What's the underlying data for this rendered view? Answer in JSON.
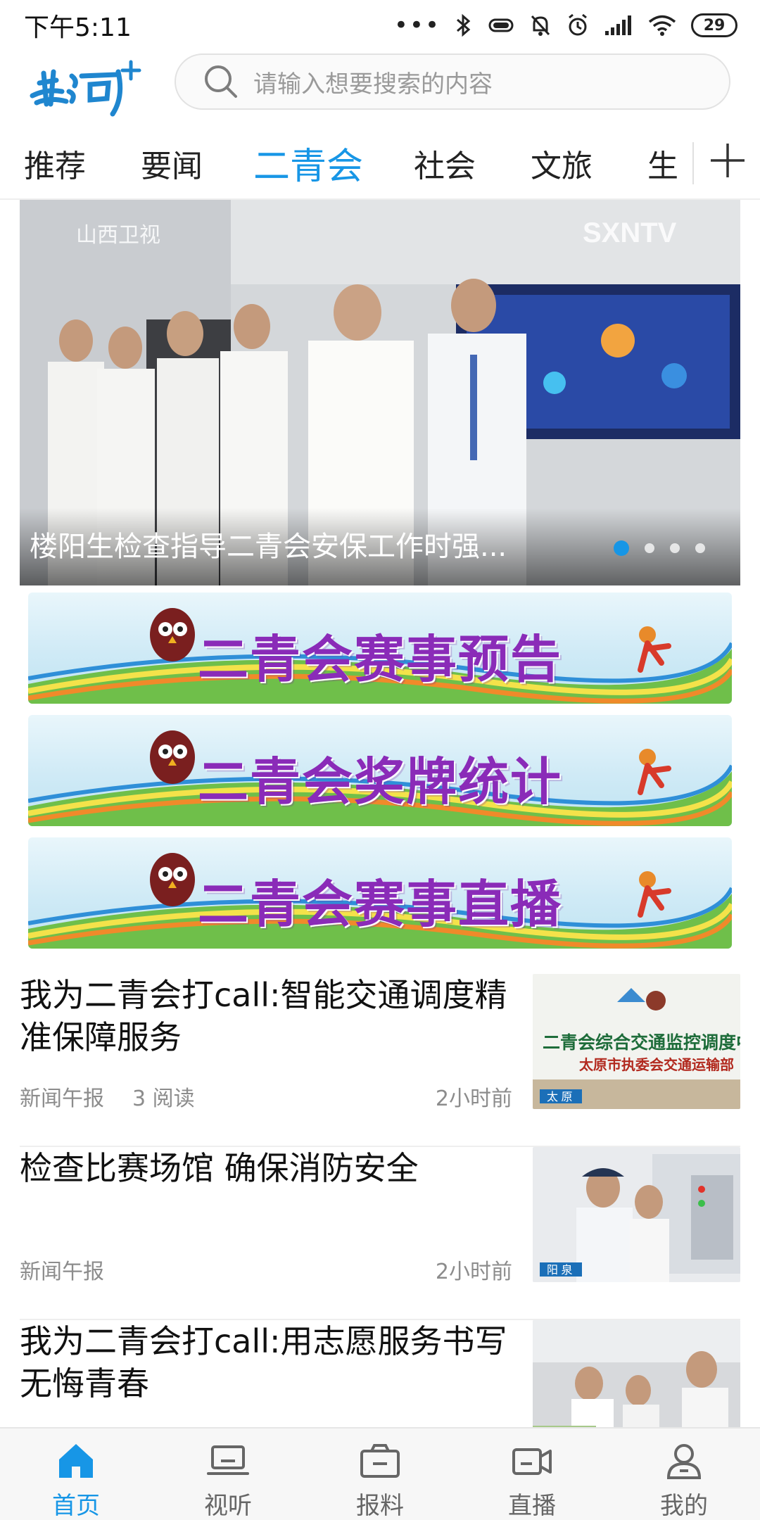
{
  "status_bar": {
    "time": "下午5:11",
    "more_dots": "•••",
    "battery": "29"
  },
  "header": {
    "logo_icon": "huanghe-plus-logo",
    "search": {
      "placeholder": "请输入想要搜索的内容",
      "icon": "search-icon"
    }
  },
  "tabs": {
    "items": [
      {
        "label": "推荐"
      },
      {
        "label": "要闻"
      },
      {
        "label": "二青会",
        "active": true
      },
      {
        "label": "社会"
      },
      {
        "label": "文旅"
      },
      {
        "label": "生"
      }
    ],
    "add_icon": "plus-icon"
  },
  "hero": {
    "title": "楼阳生检查指导二青会安保工作时强...",
    "page_count": 4,
    "active_page": 1,
    "active_color": "#1796e6"
  },
  "banners": [
    {
      "label": "二青会赛事预告"
    },
    {
      "label": "二青会奖牌统计"
    },
    {
      "label": "二青会赛事直播"
    }
  ],
  "news": [
    {
      "title": "我为二青会打call:智能交通调度精准保障服务",
      "source": "新闻午报",
      "reads": "3 阅读",
      "time": "2小时前",
      "thumb": {
        "sign_line1": "二青会综合交通监控调度中心",
        "sign_line2": "太原市执委会交通运输部",
        "tag": "太 原"
      }
    },
    {
      "title": "检查比赛场馆 确保消防安全",
      "source": "新闻午报",
      "time": "2小时前",
      "thumb": {
        "tag": "阳 泉"
      }
    },
    {
      "title": "我为二青会打call:用志愿服务书写无悔青春"
    }
  ],
  "bottom_nav": {
    "items": [
      {
        "label": "首页",
        "icon": "home-icon",
        "active": true
      },
      {
        "label": "视听",
        "icon": "laptop-icon"
      },
      {
        "label": "报料",
        "icon": "camera-icon"
      },
      {
        "label": "直播",
        "icon": "video-camera-icon"
      },
      {
        "label": "我的",
        "icon": "user-icon"
      }
    ]
  },
  "colors": {
    "accent": "#1796e6",
    "text": "#111111",
    "meta": "#8c8c8c",
    "banner_text": "#8a2bb8"
  }
}
